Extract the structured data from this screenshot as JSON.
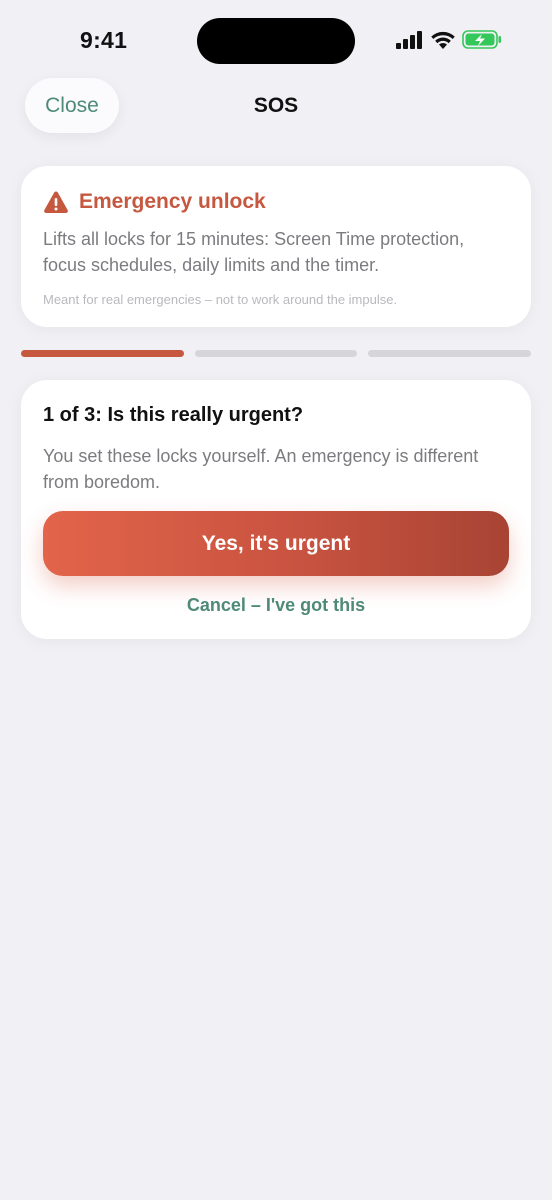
{
  "status_bar": {
    "time": "9:41",
    "icons": [
      "cellular-signal-icon",
      "wifi-icon",
      "battery-charging-icon"
    ]
  },
  "nav": {
    "close_label": "Close",
    "title": "SOS"
  },
  "info_card": {
    "icon": "warning-triangle-icon",
    "title": "Emergency unlock",
    "body": "Lifts all locks for 15 minutes: Screen Time protection, focus schedules, daily limits and the timer.",
    "note": "Meant for real emergencies – not to work around the impulse."
  },
  "progress": {
    "current_step": 1,
    "total_steps": 3
  },
  "step_card": {
    "title": "1 of 3: Is this really urgent?",
    "body": "You set these locks yourself. An emergency is different from boredom.",
    "confirm_label": "Yes, it's urgent",
    "cancel_label": "Cancel – I've got this"
  },
  "colors": {
    "background": "#f1f0f5",
    "accent_red": "#c65840",
    "accent_green": "#4e8a77",
    "battery_green": "#34c759"
  }
}
